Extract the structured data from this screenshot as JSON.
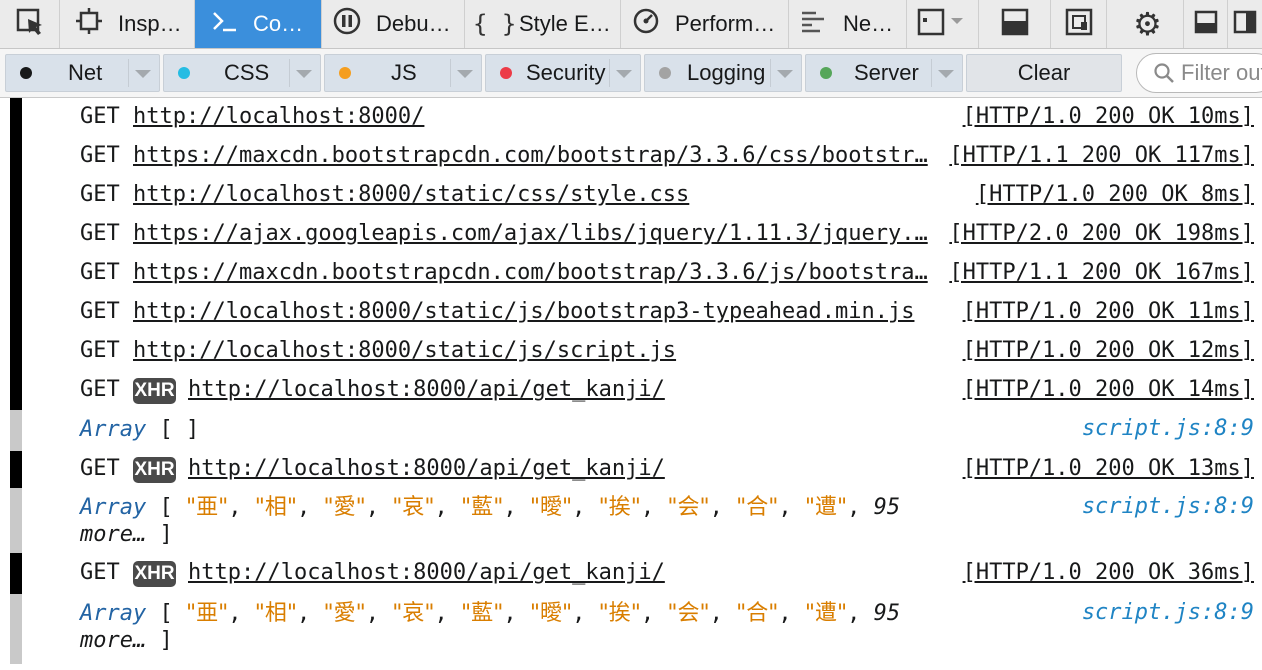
{
  "toolbar": {
    "tabs": [
      {
        "label": "Inspector",
        "icon": "inspector-icon"
      },
      {
        "label": "Console",
        "icon": "console-icon"
      },
      {
        "label": "Debugger",
        "icon": "debugger-icon"
      },
      {
        "label": "Style Editor",
        "icon": "style-editor-icon"
      },
      {
        "label": "Performance",
        "icon": "performance-icon"
      },
      {
        "label": "Network",
        "icon": "network-icon"
      }
    ],
    "active_tab": "Console",
    "pick_icon": "pick-element-icon",
    "right_icons": [
      "frame-picker-icon",
      "split-console-icon",
      "responsive-mode-icon",
      "settings-gear-icon",
      "dock-bottom-icon",
      "dock-side-icon"
    ],
    "active_color": "#3b8fdc"
  },
  "filters": {
    "items": [
      {
        "label": "Net",
        "color": "#18191a"
      },
      {
        "label": "CSS",
        "color": "#25bce3"
      },
      {
        "label": "JS",
        "color": "#f59e1f"
      },
      {
        "label": "Security",
        "color": "#ec3b47"
      },
      {
        "label": "Logging",
        "color": "#a3a3a3"
      },
      {
        "label": "Server",
        "color": "#56a65a"
      }
    ],
    "clear_label": "Clear",
    "search_placeholder": "Filter output"
  },
  "messages": [
    {
      "kind": "request",
      "method": "GET",
      "xhr": false,
      "url": "http://localhost:8000/",
      "status": "[HTTP/1.0 200 OK 10ms]"
    },
    {
      "kind": "request",
      "method": "GET",
      "xhr": false,
      "url": "https://maxcdn.bootstrapcdn.com/bootstrap/3.3.6/css/bootstr…",
      "status": "[HTTP/1.1 200 OK 117ms]"
    },
    {
      "kind": "request",
      "method": "GET",
      "xhr": false,
      "url": "http://localhost:8000/static/css/style.css",
      "status": "[HTTP/1.0 200 OK 8ms]"
    },
    {
      "kind": "request",
      "method": "GET",
      "xhr": false,
      "url": "https://ajax.googleapis.com/ajax/libs/jquery/1.11.3/jquery.…",
      "status": "[HTTP/2.0 200 OK 198ms]"
    },
    {
      "kind": "request",
      "method": "GET",
      "xhr": false,
      "url": "https://maxcdn.bootstrapcdn.com/bootstrap/3.3.6/js/bootstra…",
      "status": "[HTTP/1.1 200 OK 167ms]"
    },
    {
      "kind": "request",
      "method": "GET",
      "xhr": false,
      "url": "http://localhost:8000/static/js/bootstrap3-typeahead.min.js",
      "status": "[HTTP/1.0 200 OK 11ms]"
    },
    {
      "kind": "request",
      "method": "GET",
      "xhr": false,
      "url": "http://localhost:8000/static/js/script.js",
      "status": "[HTTP/1.0 200 OK 12ms]"
    },
    {
      "kind": "request",
      "method": "GET",
      "xhr": true,
      "xhr_label": "XHR",
      "url": "http://localhost:8000/api/get_kanji/",
      "status": "[HTTP/1.0 200 OK 14ms]"
    },
    {
      "kind": "log",
      "array_label": "Array",
      "open": "[",
      "items": [],
      "more": "",
      "close": "]",
      "source": "script.js:8:9"
    },
    {
      "kind": "request",
      "method": "GET",
      "xhr": true,
      "xhr_label": "XHR",
      "url": "http://localhost:8000/api/get_kanji/",
      "status": "[HTTP/1.0 200 OK 13ms]"
    },
    {
      "kind": "log",
      "array_label": "Array",
      "open": "[",
      "items": [
        "亜",
        "相",
        "愛",
        "哀",
        "藍",
        "曖",
        "挨",
        "会",
        "合",
        "遭"
      ],
      "more": "95 more…",
      "close": "]",
      "source": "script.js:8:9"
    },
    {
      "kind": "request",
      "method": "GET",
      "xhr": true,
      "xhr_label": "XHR",
      "url": "http://localhost:8000/api/get_kanji/",
      "status": "[HTTP/1.0 200 OK 36ms]"
    },
    {
      "kind": "log",
      "array_label": "Array",
      "open": "[",
      "items": [
        "亜",
        "相",
        "愛",
        "哀",
        "藍",
        "曖",
        "挨",
        "会",
        "合",
        "遭"
      ],
      "more": "95 more…",
      "close": "]",
      "source": "script.js:8:9"
    }
  ]
}
